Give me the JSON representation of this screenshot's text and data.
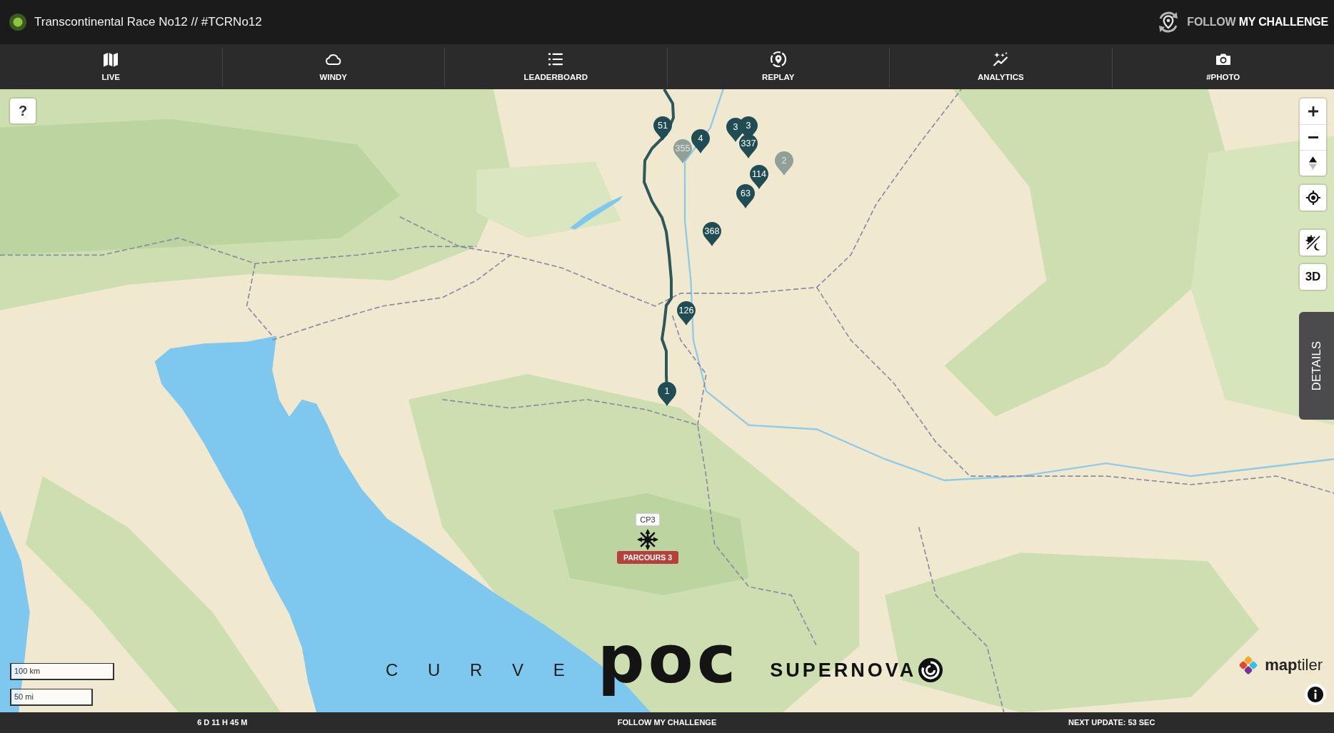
{
  "header": {
    "live": true,
    "title": "Transcontinental Race No12 // #TCRNo12",
    "brand": "FOLLOW **MY CHALLENGE**"
  },
  "tabs": [
    {
      "label": "LIVE"
    },
    {
      "label": "WINDY"
    },
    {
      "label": "LEADERBOARD"
    },
    {
      "label": "REPLAY"
    },
    {
      "label": "ANALYTICS"
    },
    {
      "label": "#PHOTO"
    }
  ],
  "map": {
    "help_button": "?",
    "markers": [
      {
        "label": "51",
        "inactive": false
      },
      {
        "label": "4",
        "inactive": false
      },
      {
        "label": "355",
        "inactive": true
      },
      {
        "label": "3",
        "inactive": false
      },
      {
        "label": "3",
        "inactive": false
      },
      {
        "label": "337",
        "inactive": false
      },
      {
        "label": "2",
        "inactive": true
      },
      {
        "label": "114",
        "inactive": false
      },
      {
        "label": "63",
        "inactive": false
      },
      {
        "label": "368",
        "inactive": false
      },
      {
        "label": "126",
        "inactive": false
      },
      {
        "label": "1",
        "inactive": false
      }
    ],
    "checkpoint": {
      "label": "CP3",
      "badge": "PARCOURS 3"
    },
    "three_d_button": "3D",
    "details_tab": "DETAILS",
    "scale": [
      "100 km",
      "50 mi"
    ],
    "sponsors": [
      "C U R V E",
      "poc",
      "SUPERNOVA"
    ],
    "attribution": "**map**tiler"
  },
  "footer": [
    "6 D 11 H 45 M",
    "FOLLOW MY CHALLENGE",
    "NEXT UPDATE: 53 SEC"
  ]
}
